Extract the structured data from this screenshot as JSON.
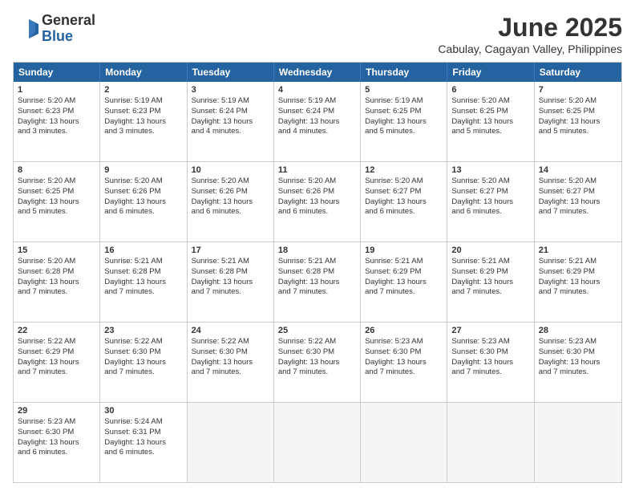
{
  "logo": {
    "general": "General",
    "blue": "Blue"
  },
  "title": "June 2025",
  "subtitle": "Cabulay, Cagayan Valley, Philippines",
  "header_days": [
    "Sunday",
    "Monday",
    "Tuesday",
    "Wednesday",
    "Thursday",
    "Friday",
    "Saturday"
  ],
  "rows": [
    [
      {
        "day": "1",
        "lines": [
          "Sunrise: 5:20 AM",
          "Sunset: 6:23 PM",
          "Daylight: 13 hours",
          "and 3 minutes."
        ]
      },
      {
        "day": "2",
        "lines": [
          "Sunrise: 5:19 AM",
          "Sunset: 6:23 PM",
          "Daylight: 13 hours",
          "and 3 minutes."
        ]
      },
      {
        "day": "3",
        "lines": [
          "Sunrise: 5:19 AM",
          "Sunset: 6:24 PM",
          "Daylight: 13 hours",
          "and 4 minutes."
        ]
      },
      {
        "day": "4",
        "lines": [
          "Sunrise: 5:19 AM",
          "Sunset: 6:24 PM",
          "Daylight: 13 hours",
          "and 4 minutes."
        ]
      },
      {
        "day": "5",
        "lines": [
          "Sunrise: 5:19 AM",
          "Sunset: 6:25 PM",
          "Daylight: 13 hours",
          "and 5 minutes."
        ]
      },
      {
        "day": "6",
        "lines": [
          "Sunrise: 5:20 AM",
          "Sunset: 6:25 PM",
          "Daylight: 13 hours",
          "and 5 minutes."
        ]
      },
      {
        "day": "7",
        "lines": [
          "Sunrise: 5:20 AM",
          "Sunset: 6:25 PM",
          "Daylight: 13 hours",
          "and 5 minutes."
        ]
      }
    ],
    [
      {
        "day": "8",
        "lines": [
          "Sunrise: 5:20 AM",
          "Sunset: 6:25 PM",
          "Daylight: 13 hours",
          "and 5 minutes."
        ]
      },
      {
        "day": "9",
        "lines": [
          "Sunrise: 5:20 AM",
          "Sunset: 6:26 PM",
          "Daylight: 13 hours",
          "and 6 minutes."
        ]
      },
      {
        "day": "10",
        "lines": [
          "Sunrise: 5:20 AM",
          "Sunset: 6:26 PM",
          "Daylight: 13 hours",
          "and 6 minutes."
        ]
      },
      {
        "day": "11",
        "lines": [
          "Sunrise: 5:20 AM",
          "Sunset: 6:26 PM",
          "Daylight: 13 hours",
          "and 6 minutes."
        ]
      },
      {
        "day": "12",
        "lines": [
          "Sunrise: 5:20 AM",
          "Sunset: 6:27 PM",
          "Daylight: 13 hours",
          "and 6 minutes."
        ]
      },
      {
        "day": "13",
        "lines": [
          "Sunrise: 5:20 AM",
          "Sunset: 6:27 PM",
          "Daylight: 13 hours",
          "and 6 minutes."
        ]
      },
      {
        "day": "14",
        "lines": [
          "Sunrise: 5:20 AM",
          "Sunset: 6:27 PM",
          "Daylight: 13 hours",
          "and 7 minutes."
        ]
      }
    ],
    [
      {
        "day": "15",
        "lines": [
          "Sunrise: 5:20 AM",
          "Sunset: 6:28 PM",
          "Daylight: 13 hours",
          "and 7 minutes."
        ]
      },
      {
        "day": "16",
        "lines": [
          "Sunrise: 5:21 AM",
          "Sunset: 6:28 PM",
          "Daylight: 13 hours",
          "and 7 minutes."
        ]
      },
      {
        "day": "17",
        "lines": [
          "Sunrise: 5:21 AM",
          "Sunset: 6:28 PM",
          "Daylight: 13 hours",
          "and 7 minutes."
        ]
      },
      {
        "day": "18",
        "lines": [
          "Sunrise: 5:21 AM",
          "Sunset: 6:28 PM",
          "Daylight: 13 hours",
          "and 7 minutes."
        ]
      },
      {
        "day": "19",
        "lines": [
          "Sunrise: 5:21 AM",
          "Sunset: 6:29 PM",
          "Daylight: 13 hours",
          "and 7 minutes."
        ]
      },
      {
        "day": "20",
        "lines": [
          "Sunrise: 5:21 AM",
          "Sunset: 6:29 PM",
          "Daylight: 13 hours",
          "and 7 minutes."
        ]
      },
      {
        "day": "21",
        "lines": [
          "Sunrise: 5:21 AM",
          "Sunset: 6:29 PM",
          "Daylight: 13 hours",
          "and 7 minutes."
        ]
      }
    ],
    [
      {
        "day": "22",
        "lines": [
          "Sunrise: 5:22 AM",
          "Sunset: 6:29 PM",
          "Daylight: 13 hours",
          "and 7 minutes."
        ]
      },
      {
        "day": "23",
        "lines": [
          "Sunrise: 5:22 AM",
          "Sunset: 6:30 PM",
          "Daylight: 13 hours",
          "and 7 minutes."
        ]
      },
      {
        "day": "24",
        "lines": [
          "Sunrise: 5:22 AM",
          "Sunset: 6:30 PM",
          "Daylight: 13 hours",
          "and 7 minutes."
        ]
      },
      {
        "day": "25",
        "lines": [
          "Sunrise: 5:22 AM",
          "Sunset: 6:30 PM",
          "Daylight: 13 hours",
          "and 7 minutes."
        ]
      },
      {
        "day": "26",
        "lines": [
          "Sunrise: 5:23 AM",
          "Sunset: 6:30 PM",
          "Daylight: 13 hours",
          "and 7 minutes."
        ]
      },
      {
        "day": "27",
        "lines": [
          "Sunrise: 5:23 AM",
          "Sunset: 6:30 PM",
          "Daylight: 13 hours",
          "and 7 minutes."
        ]
      },
      {
        "day": "28",
        "lines": [
          "Sunrise: 5:23 AM",
          "Sunset: 6:30 PM",
          "Daylight: 13 hours",
          "and 7 minutes."
        ]
      }
    ],
    [
      {
        "day": "29",
        "lines": [
          "Sunrise: 5:23 AM",
          "Sunset: 6:30 PM",
          "Daylight: 13 hours",
          "and 6 minutes."
        ]
      },
      {
        "day": "30",
        "lines": [
          "Sunrise: 5:24 AM",
          "Sunset: 6:31 PM",
          "Daylight: 13 hours",
          "and 6 minutes."
        ]
      },
      {
        "day": "",
        "lines": []
      },
      {
        "day": "",
        "lines": []
      },
      {
        "day": "",
        "lines": []
      },
      {
        "day": "",
        "lines": []
      },
      {
        "day": "",
        "lines": []
      }
    ]
  ]
}
